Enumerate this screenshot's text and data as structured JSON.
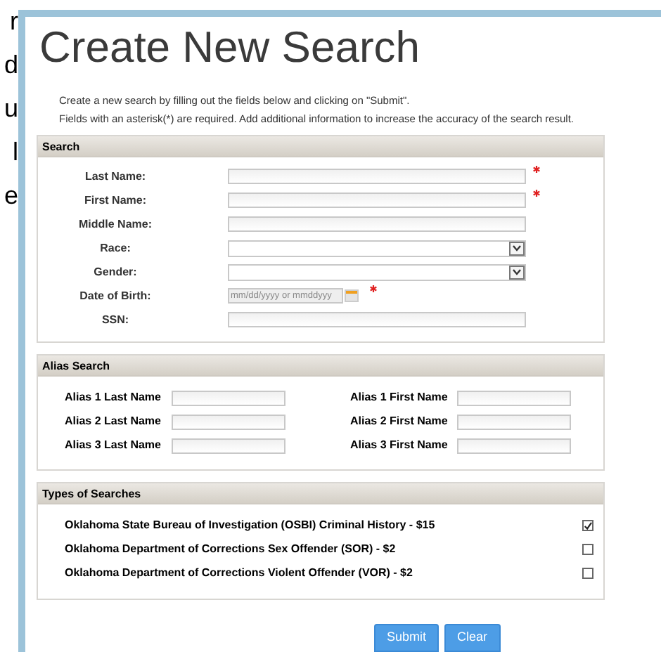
{
  "edge_fragments": [
    "r",
    "d",
    "u",
    "l",
    "e"
  ],
  "title": "Create New Search",
  "intro": [
    "Create a new search by filling out the fields below and clicking on \"Submit\".",
    "Fields with an asterisk(*) are required. Add additional information to increase the accuracy of the search result."
  ],
  "search": {
    "heading": "Search",
    "fields": [
      {
        "label": "Last Name:",
        "kind": "text",
        "required": true
      },
      {
        "label": "First Name:",
        "kind": "text",
        "required": true
      },
      {
        "label": "Middle Name:",
        "kind": "text",
        "required": false
      },
      {
        "label": "Race:",
        "kind": "select",
        "required": false
      },
      {
        "label": "Gender:",
        "kind": "select",
        "required": false
      },
      {
        "label": "Date of Birth:",
        "kind": "date",
        "placeholder": "mm/dd/yyyy or mmddyyy",
        "required": true
      },
      {
        "label": "SSN:",
        "kind": "text",
        "required": false
      }
    ]
  },
  "alias_search": {
    "heading": "Alias Search",
    "fields": [
      {
        "label": "Alias 1 Last Name"
      },
      {
        "label": "Alias 1 First Name"
      },
      {
        "label": "Alias 2 Last Name"
      },
      {
        "label": "Alias 2 First Name"
      },
      {
        "label": "Alias 3 Last Name"
      },
      {
        "label": "Alias 3 First Name"
      }
    ]
  },
  "types_of_searches": {
    "heading": "Types of Searches",
    "options": [
      {
        "label": "Oklahoma State Bureau of Investigation (OSBI) Criminal History - $15",
        "checked": true
      },
      {
        "label": "Oklahoma Department of Corrections Sex Offender (SOR) - $2",
        "checked": false
      },
      {
        "label": "Oklahoma Department of Corrections Violent Offender (VOR) - $2",
        "checked": false
      }
    ]
  },
  "buttons": [
    "Submit",
    "Clear"
  ]
}
